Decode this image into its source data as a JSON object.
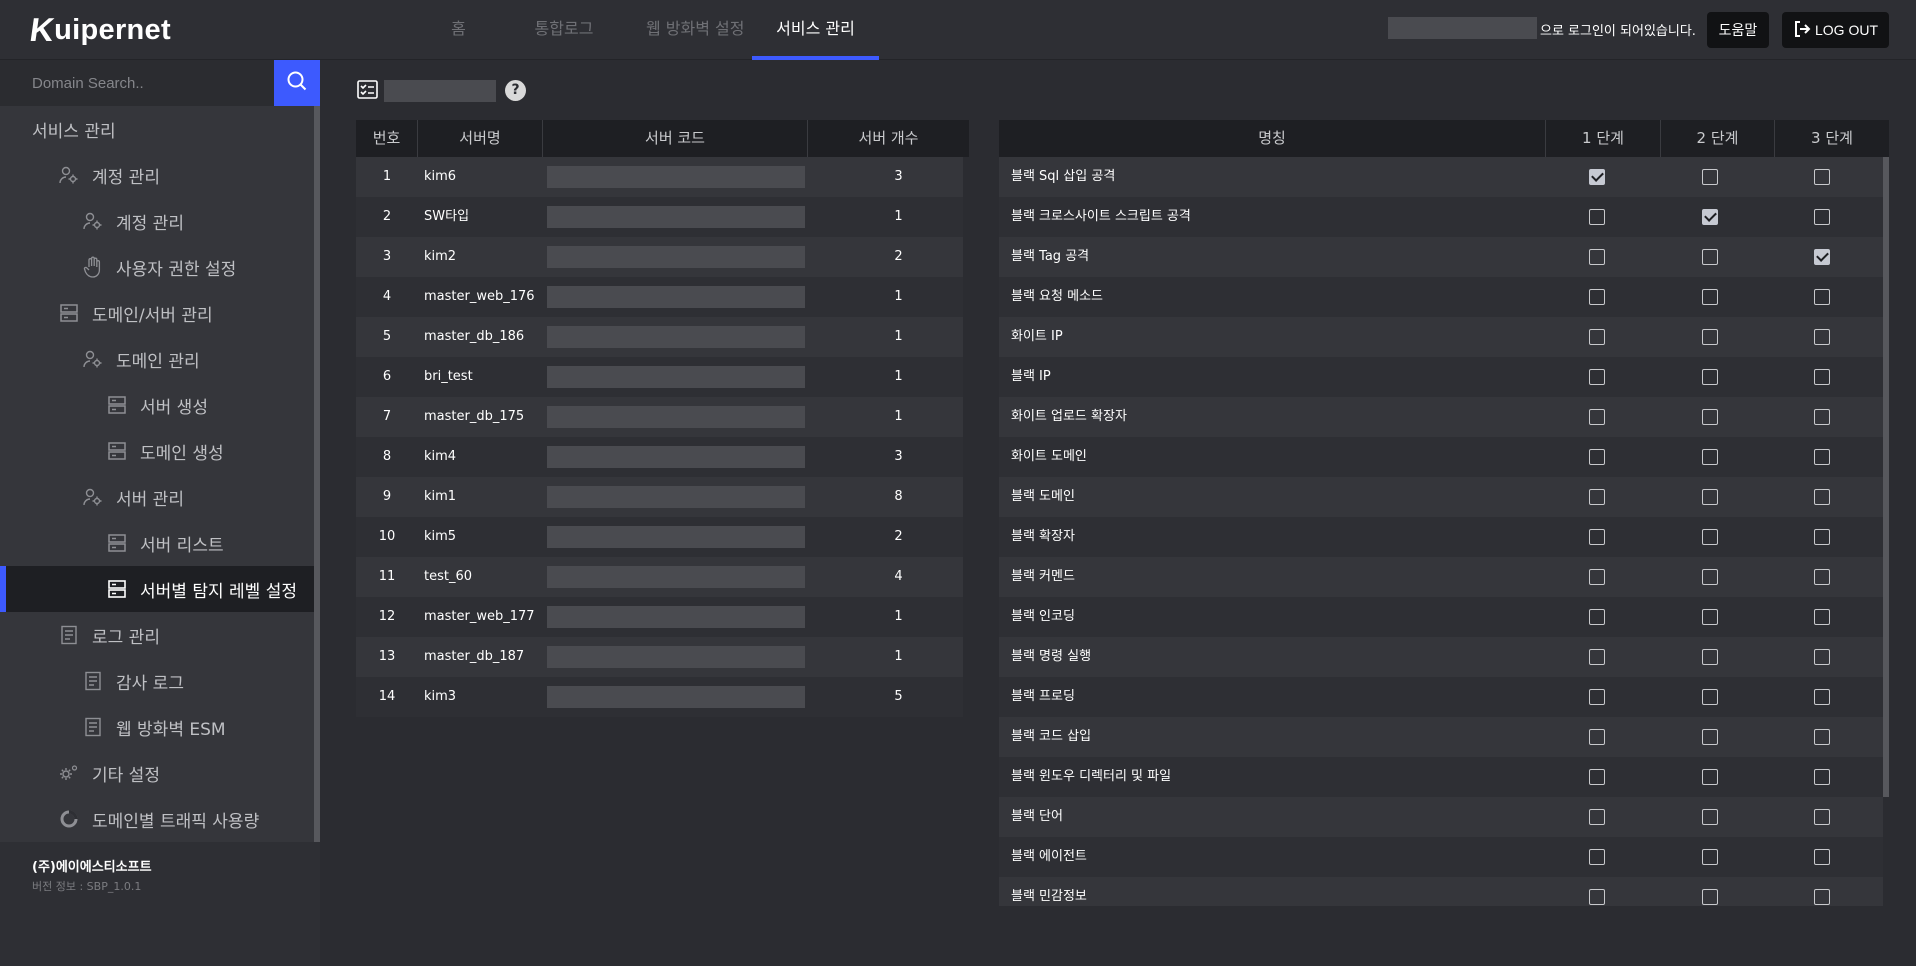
{
  "app": {
    "logo_text": "Kuipernet",
    "nav_tabs": [
      "홈",
      "통합로그",
      "웹 방화벽 설정",
      "서비스 관리"
    ],
    "active_tab": "서비스 관리",
    "login_suffix": "으로 로그인이 되어있습니다.",
    "help_label": "도움말",
    "logout_label": "LOG OUT"
  },
  "colors": {
    "accent": "#3d5afe",
    "background": "#2b2c31",
    "sidebar": "#35363b",
    "header_row": "#1e1f23"
  },
  "sidebar": {
    "search_placeholder": "Domain Search..",
    "items": [
      {
        "label": "서비스 관리",
        "level": 0,
        "icon": "none"
      },
      {
        "label": "계정 관리",
        "level": 1,
        "icon": "user-gear-icon"
      },
      {
        "label": "계정 관리",
        "level": 2,
        "icon": "user-gear-icon"
      },
      {
        "label": "사용자 권한 설정",
        "level": 2,
        "icon": "hand-icon"
      },
      {
        "label": "도메인/서버 관리",
        "level": 1,
        "icon": "server-icon"
      },
      {
        "label": "도메인 관리",
        "level": 2,
        "icon": "user-gear-icon"
      },
      {
        "label": "서버 생성",
        "level": 3,
        "icon": "server-icon"
      },
      {
        "label": "도메인 생성",
        "level": 3,
        "icon": "server-icon"
      },
      {
        "label": "서버 관리",
        "level": 2,
        "icon": "user-gear-icon"
      },
      {
        "label": "서버 리스트",
        "level": 3,
        "icon": "server-icon"
      },
      {
        "label": "서버별 탐지 레벨 설정",
        "level": 3,
        "icon": "server-icon",
        "active": true
      },
      {
        "label": "로그 관리",
        "level": 1,
        "icon": "document-icon"
      },
      {
        "label": "감사 로그",
        "level": 2,
        "icon": "document-icon"
      },
      {
        "label": "웹 방화벽 ESM",
        "level": 2,
        "icon": "document-icon"
      },
      {
        "label": "기타 설정",
        "level": 1,
        "icon": "gears-icon"
      },
      {
        "label": "도메인별 트래픽 사용량",
        "level": 1,
        "icon": "donut-icon"
      }
    ],
    "company": "(주)에이에스티소프트",
    "version": "버전 정보 : SBP_1.0.1"
  },
  "server_table": {
    "headers": [
      "번호",
      "서버명",
      "서버 코드",
      "서버 개수"
    ],
    "rows": [
      {
        "no": "1",
        "name": "kim6",
        "count": "3"
      },
      {
        "no": "2",
        "name": "SW타입",
        "count": "1"
      },
      {
        "no": "3",
        "name": "kim2",
        "count": "2"
      },
      {
        "no": "4",
        "name": "master_web_176",
        "count": "1"
      },
      {
        "no": "5",
        "name": "master_db_186",
        "count": "1"
      },
      {
        "no": "6",
        "name": "bri_test",
        "count": "1"
      },
      {
        "no": "7",
        "name": "master_db_175",
        "count": "1"
      },
      {
        "no": "8",
        "name": "kim4",
        "count": "3"
      },
      {
        "no": "9",
        "name": "kim1",
        "count": "8"
      },
      {
        "no": "10",
        "name": "kim5",
        "count": "2"
      },
      {
        "no": "11",
        "name": "test_60",
        "count": "4"
      },
      {
        "no": "12",
        "name": "master_web_177",
        "count": "1"
      },
      {
        "no": "13",
        "name": "master_db_187",
        "count": "1"
      },
      {
        "no": "14",
        "name": "kim3",
        "count": "5"
      }
    ]
  },
  "rule_table": {
    "headers": [
      "명칭",
      "1 단계",
      "2 단계",
      "3 단계"
    ],
    "rows": [
      {
        "name": "블랙 Sql 삽입 공격",
        "levels": [
          true,
          false,
          false
        ]
      },
      {
        "name": "블랙 크로스사이트 스크립트 공격",
        "levels": [
          false,
          true,
          false
        ]
      },
      {
        "name": "블랙 Tag 공격",
        "levels": [
          false,
          false,
          true
        ]
      },
      {
        "name": "블랙 요청 메소드",
        "levels": [
          false,
          false,
          false
        ]
      },
      {
        "name": "화이트 IP",
        "levels": [
          false,
          false,
          false
        ]
      },
      {
        "name": "블랙 IP",
        "levels": [
          false,
          false,
          false
        ]
      },
      {
        "name": "화이트 업로드 확장자",
        "levels": [
          false,
          false,
          false
        ]
      },
      {
        "name": "화이트 도메인",
        "levels": [
          false,
          false,
          false
        ]
      },
      {
        "name": "블랙 도메인",
        "levels": [
          false,
          false,
          false
        ]
      },
      {
        "name": "블랙 확장자",
        "levels": [
          false,
          false,
          false
        ]
      },
      {
        "name": "블랙 커멘드",
        "levels": [
          false,
          false,
          false
        ]
      },
      {
        "name": "블랙 인코딩",
        "levels": [
          false,
          false,
          false
        ]
      },
      {
        "name": "블랙 명령 실행",
        "levels": [
          false,
          false,
          false
        ]
      },
      {
        "name": "블랙 프로딩",
        "levels": [
          false,
          false,
          false
        ]
      },
      {
        "name": "블랙 코드 삽입",
        "levels": [
          false,
          false,
          false
        ]
      },
      {
        "name": "블랙 윈도우 디렉터리 및 파일",
        "levels": [
          false,
          false,
          false
        ]
      },
      {
        "name": "블랙 단어",
        "levels": [
          false,
          false,
          false
        ]
      },
      {
        "name": "블랙 에이전트",
        "levels": [
          false,
          false,
          false
        ]
      },
      {
        "name": "블랙 민감정보",
        "levels": [
          false,
          false,
          false
        ]
      }
    ]
  }
}
